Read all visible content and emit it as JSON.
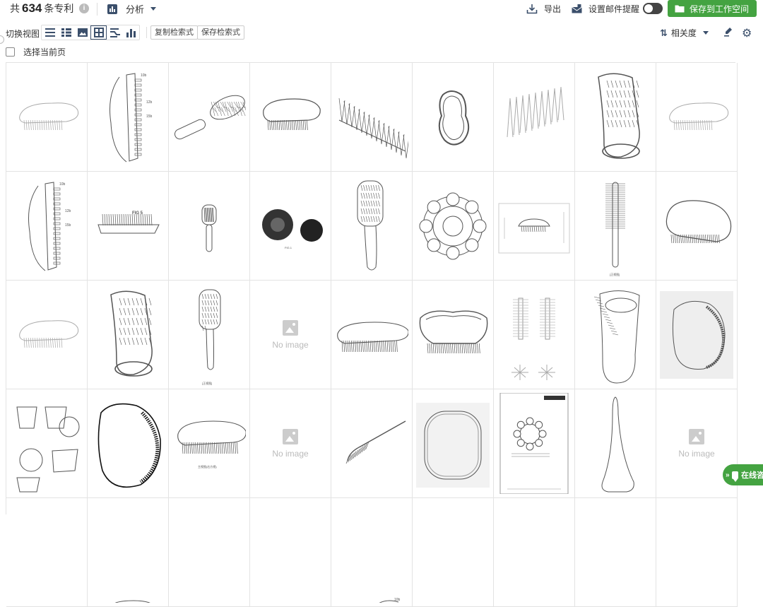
{
  "header": {
    "count_prefix": "共",
    "count_value": "634",
    "count_suffix": "条专利",
    "analysis_label": "分析",
    "export_label": "导出",
    "email_alert_label": "设置邮件提醒",
    "email_alert_enabled": false,
    "save_workspace_label": "保存到工作空间"
  },
  "toolbar": {
    "switch_view_label": "切换视图",
    "views": [
      "list-icon",
      "detail-list-icon",
      "image-icon",
      "grid-icon",
      "compare-icon",
      "chart-icon"
    ],
    "active_view": "grid-icon",
    "copy_query_label": "复制检索式",
    "save_query_label": "保存检索式",
    "sort_label": "相关度"
  },
  "selection": {
    "select_page_label": "选择当前页"
  },
  "grid": {
    "no_image_label": "No image",
    "cells": [
      "brush-oval-light",
      "patent-drawing-side",
      "round-brush",
      "oval-brush",
      "bristle-row",
      "bean-outline",
      "tine-row-light",
      "tangle-tall",
      "brush-oval-light",
      "patent-drawing-side",
      "bristle-strip-fig",
      "paddle-small",
      "dark-blobs",
      "paddle-brush",
      "flower-ring",
      "patent-sheet",
      "round-brush-vertical",
      "tangle-oval",
      "brush-oval-light",
      "tangle-tall",
      "paddle-tall",
      "no-image",
      "oval-brush-wide",
      "tangle-shell",
      "two-round-brushes",
      "tangle-tall-outline",
      "tangle-gray",
      "cups-set",
      "tangle-black",
      "oval-brush-label",
      "no-image",
      "tail-comb",
      "rounded-square",
      "doc-flower",
      "cone-outline",
      "no-image",
      "blank",
      "oval-partial",
      "blank",
      "blank",
      "patent-partial",
      "blank",
      "blank",
      "blank",
      "blank"
    ]
  },
  "chat": {
    "label": "在线咨询"
  }
}
